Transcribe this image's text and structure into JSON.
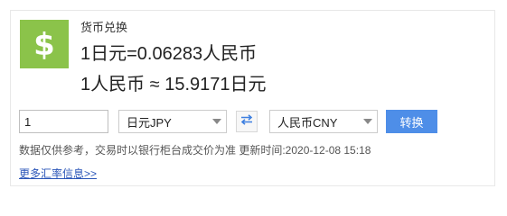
{
  "widget": {
    "title": "货币兑换",
    "logo_icon": "dollar-sign-icon",
    "logo_color": "#8bc34a",
    "rate_line_1": "1日元=0.06283人民币",
    "rate_line_2": "1人民币 ≈ 15.9171日元"
  },
  "converter": {
    "amount_value": "1",
    "from_currency": "日元JPY",
    "to_currency": "人民币CNY",
    "swap_icon": "swap-arrows-icon",
    "swap_color": "#3d7fe0",
    "convert_label": "转换",
    "convert_color": "#4e8ee8"
  },
  "footer": {
    "note_text": "数据仅供参考，交易时以银行柜台成交价为准 更新时间:2020-12-08 15:18",
    "more_link_text": "更多汇率信息>>",
    "link_color": "#2a55b8"
  }
}
